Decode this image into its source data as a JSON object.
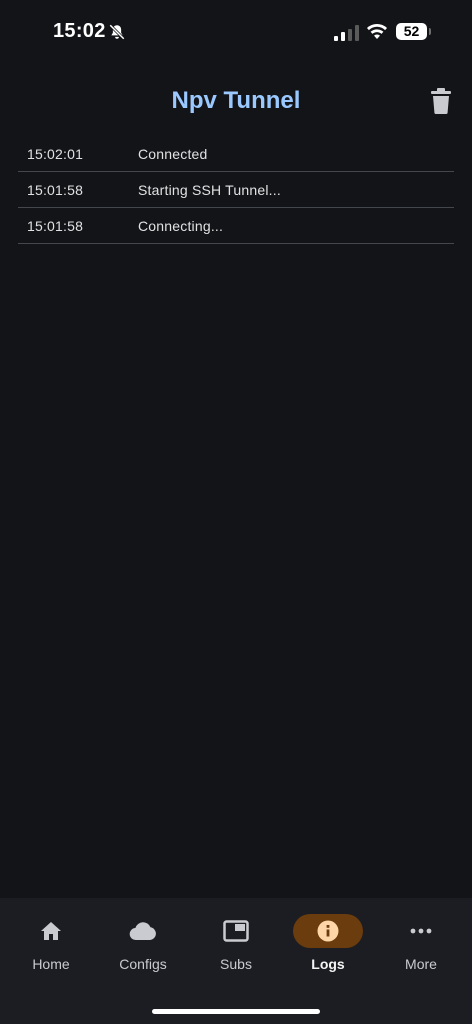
{
  "status_bar": {
    "time": "15:02",
    "battery_level": "52",
    "icons": [
      "bell-slash-icon",
      "signal-icon",
      "wifi-icon",
      "battery-icon"
    ]
  },
  "header": {
    "title": "Npv Tunnel",
    "title_color": "#9bc9ff",
    "action_icon": "trash-icon"
  },
  "logs": [
    {
      "time": "15:02:01",
      "message": "Connected"
    },
    {
      "time": "15:01:58",
      "message": "Starting SSH Tunnel..."
    },
    {
      "time": "15:01:58",
      "message": "Connecting..."
    }
  ],
  "nav": {
    "active": "Logs",
    "active_color": "#6b3c0d",
    "items": [
      {
        "label": "Home",
        "icon": "home-icon"
      },
      {
        "label": "Configs",
        "icon": "cloud-icon"
      },
      {
        "label": "Subs",
        "icon": "picture-in-picture-icon"
      },
      {
        "label": "Logs",
        "icon": "info-icon"
      },
      {
        "label": "More",
        "icon": "more-horizontal-icon"
      }
    ]
  }
}
